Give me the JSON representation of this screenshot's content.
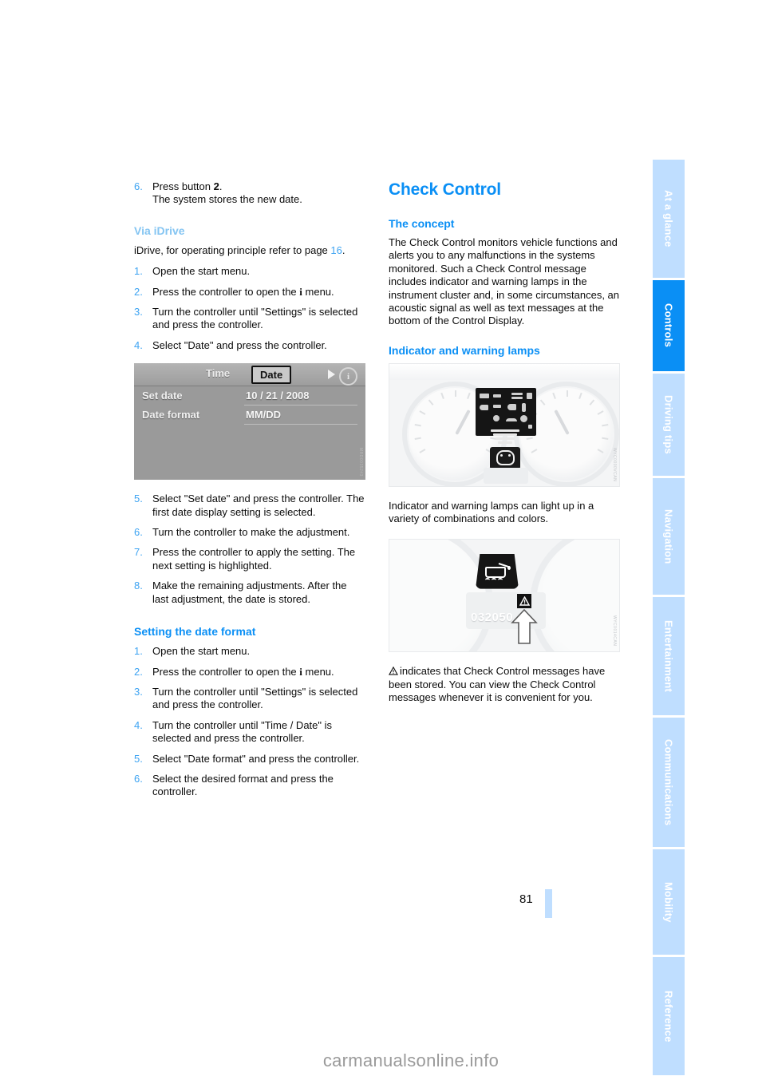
{
  "document": {
    "page_number": "81",
    "watermark": "carmanualsonline.info"
  },
  "sidebar": {
    "tabs": [
      {
        "label": "At a glance",
        "active": false
      },
      {
        "label": "Controls",
        "active": true
      },
      {
        "label": "Driving tips",
        "active": false
      },
      {
        "label": "Navigation",
        "active": false
      },
      {
        "label": "Entertainment",
        "active": false
      },
      {
        "label": "Communications",
        "active": false
      },
      {
        "label": "Mobility",
        "active": false
      },
      {
        "label": "Reference",
        "active": false
      }
    ],
    "active_color": "#0a8ff5",
    "inactive_color": "#bfdeff"
  },
  "left_column": {
    "step_carryover": {
      "num": "6.",
      "line1_pre": "Press button ",
      "line1_bold": "2",
      "line1_post": ".",
      "line2": "The system stores the new date."
    },
    "via_idrive": {
      "heading": "Via iDrive",
      "intro_pre": "iDrive, for operating principle refer to page ",
      "intro_ref": "16",
      "intro_post": ".",
      "steps": [
        {
          "num": "1.",
          "text": "Open the start menu."
        },
        {
          "num": "2.",
          "pre": "Press the controller to open the ",
          "icon": "i",
          "post": " menu."
        },
        {
          "num": "3.",
          "text": "Turn the controller until \"Settings\" is selected and press the controller."
        },
        {
          "num": "4.",
          "text": "Select \"Date\" and press the controller."
        }
      ]
    },
    "idrive_figure": {
      "tab_time": "Time",
      "tab_date": "Date",
      "info_glyph": "i",
      "rows": [
        {
          "label": "Set date",
          "value": "10 / 21 / 2008"
        },
        {
          "label": "Date format",
          "value": "MM/DD"
        }
      ],
      "watermark": "MRD0035243"
    },
    "steps_after_figure": [
      {
        "num": "5.",
        "text": "Select \"Set date\" and press the controller. The first date display setting is selected."
      },
      {
        "num": "6.",
        "text": "Turn the controller to make the adjustment."
      },
      {
        "num": "7.",
        "text": "Press the controller to apply the setting. The next setting is highlighted."
      },
      {
        "num": "8.",
        "text": "Make the remaining adjustments. After the last adjustment, the date is stored."
      }
    ],
    "date_format": {
      "heading": "Setting the date format",
      "steps": [
        {
          "num": "1.",
          "text": "Open the start menu."
        },
        {
          "num": "2.",
          "pre": "Press the controller to open the ",
          "icon": "i",
          "post": " menu."
        },
        {
          "num": "3.",
          "text": "Turn the controller until \"Settings\" is selected and press the controller."
        },
        {
          "num": "4.",
          "text": "Turn the controller until \"Time / Date\" is selected and press the controller."
        },
        {
          "num": "5.",
          "text": "Select \"Date format\" and press the controller."
        },
        {
          "num": "6.",
          "text": "Select the desired format and press the controller."
        }
      ]
    }
  },
  "right_column": {
    "chapter_title": "Check Control",
    "concept": {
      "heading": "The concept",
      "body": "The Check Control monitors vehicle functions and alerts you to any malfunctions in the systems monitored. Such a Check Control message includes indicator and warning lamps in the instrument cluster and, in some circumstances, an acoustic signal as well as text messages at the bottom of the Control Display."
    },
    "lamps": {
      "heading": "Indicator and warning lamps",
      "cluster_figure_watermark": "WYC0000VCAN",
      "caption": "Indicator and warning lamps can light up in a variety of combinations and colors."
    },
    "oil_figure": {
      "odometer": "032050",
      "watermark": "WYC0014CAN"
    },
    "stored_messages_text": "indicates that Check Control messages have been stored. You can view the Check Control messages whenever it is convenient for you."
  }
}
